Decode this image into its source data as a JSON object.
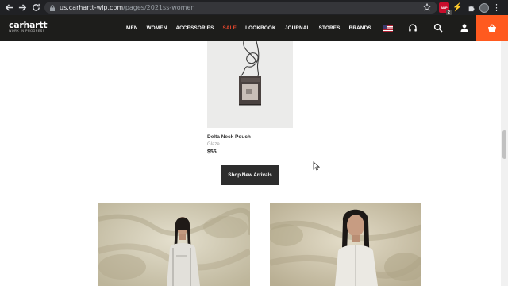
{
  "browser": {
    "url_domain": "us.carhartt-wip.com",
    "url_path": "/pages/2021ss-women",
    "ext_badge": "2",
    "menu_glyph": "⋮"
  },
  "header": {
    "logo_main": "carhartt",
    "logo_sub": "WORK IN PROGRESS",
    "nav": [
      {
        "label": "MEN"
      },
      {
        "label": "WOMEN"
      },
      {
        "label": "ACCESSORIES"
      },
      {
        "label": "SALE"
      },
      {
        "label": "LOOKBOOK"
      },
      {
        "label": "JOURNAL"
      },
      {
        "label": "STORES"
      },
      {
        "label": "BRANDS"
      }
    ],
    "icons": [
      "us-flag-icon",
      "headphones-icon",
      "search-icon",
      "account-icon",
      "basket-icon"
    ],
    "accent_color": "#ff5a1f",
    "sale_color": "#e8482e"
  },
  "product": {
    "name": "Delta Neck Pouch",
    "color": "Glaze",
    "price": "$55"
  },
  "cta": {
    "label": "Shop New Arrivals"
  }
}
